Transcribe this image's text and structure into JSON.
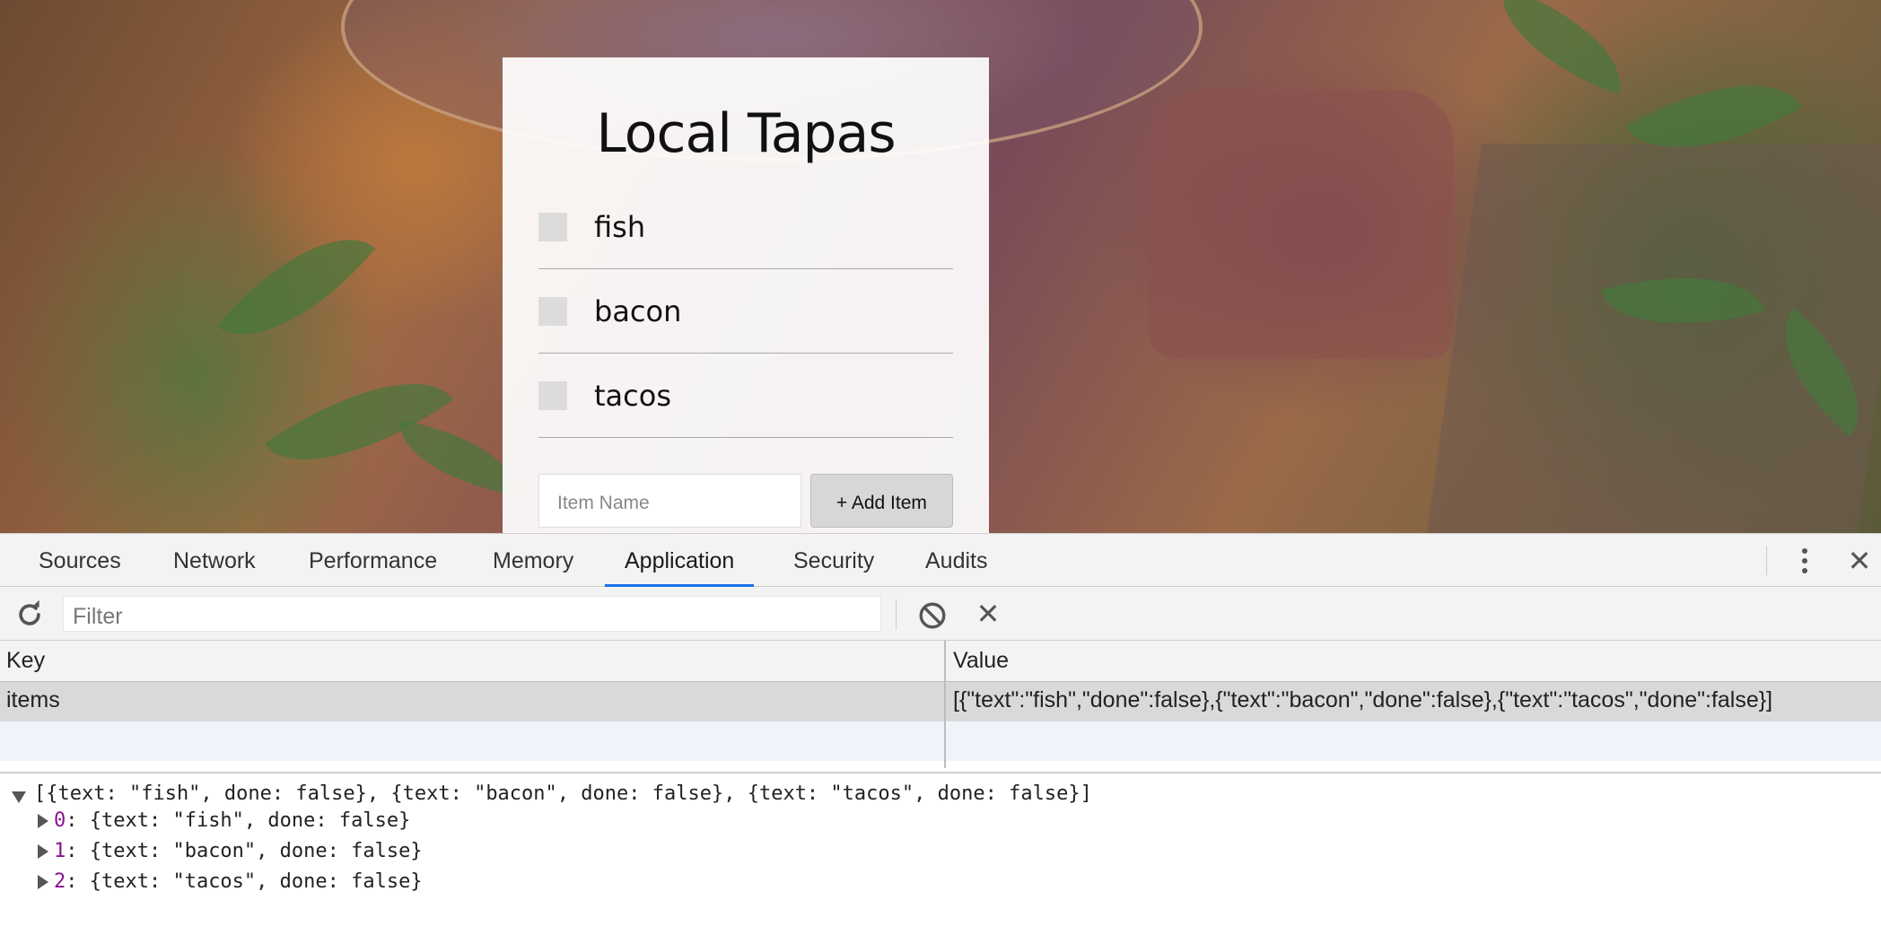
{
  "app": {
    "title": "Local Tapas",
    "items": [
      {
        "text": "fish",
        "done": false
      },
      {
        "text": "bacon",
        "done": false
      },
      {
        "text": "tacos",
        "done": false
      }
    ],
    "input_placeholder": "Item Name",
    "add_button_label": "+ Add Item"
  },
  "devtools": {
    "tabs": [
      "Sources",
      "Network",
      "Performance",
      "Memory",
      "Application",
      "Security",
      "Audits"
    ],
    "active_tab": "Application",
    "toolbar": {
      "filter_placeholder": "Filter",
      "icons": [
        "refresh-icon",
        "clear-all-icon",
        "delete-icon"
      ]
    },
    "storage_table": {
      "columns": [
        "Key",
        "Value"
      ],
      "rows": [
        {
          "key": "items",
          "value": "[{\"text\":\"fish\",\"done\":false},{\"text\":\"bacon\",\"done\":false},{\"text\":\"tacos\",\"done\":false}]",
          "selected": true
        }
      ]
    },
    "preview": {
      "summary": "[{text: \"fish\", done: false}, {text: \"bacon\", done: false}, {text: \"tacos\", done: false}]",
      "entries": [
        {
          "index": "0",
          "value": ": {text: \"fish\", done: false}"
        },
        {
          "index": "1",
          "value": ": {text: \"bacon\", done: false}"
        },
        {
          "index": "2",
          "value": ": {text: \"tacos\", done: false}"
        }
      ]
    },
    "colors": {
      "active_tab_underline": "#1a73e8",
      "selected_row": "#d9d9d9",
      "index_key": "#881391"
    }
  }
}
